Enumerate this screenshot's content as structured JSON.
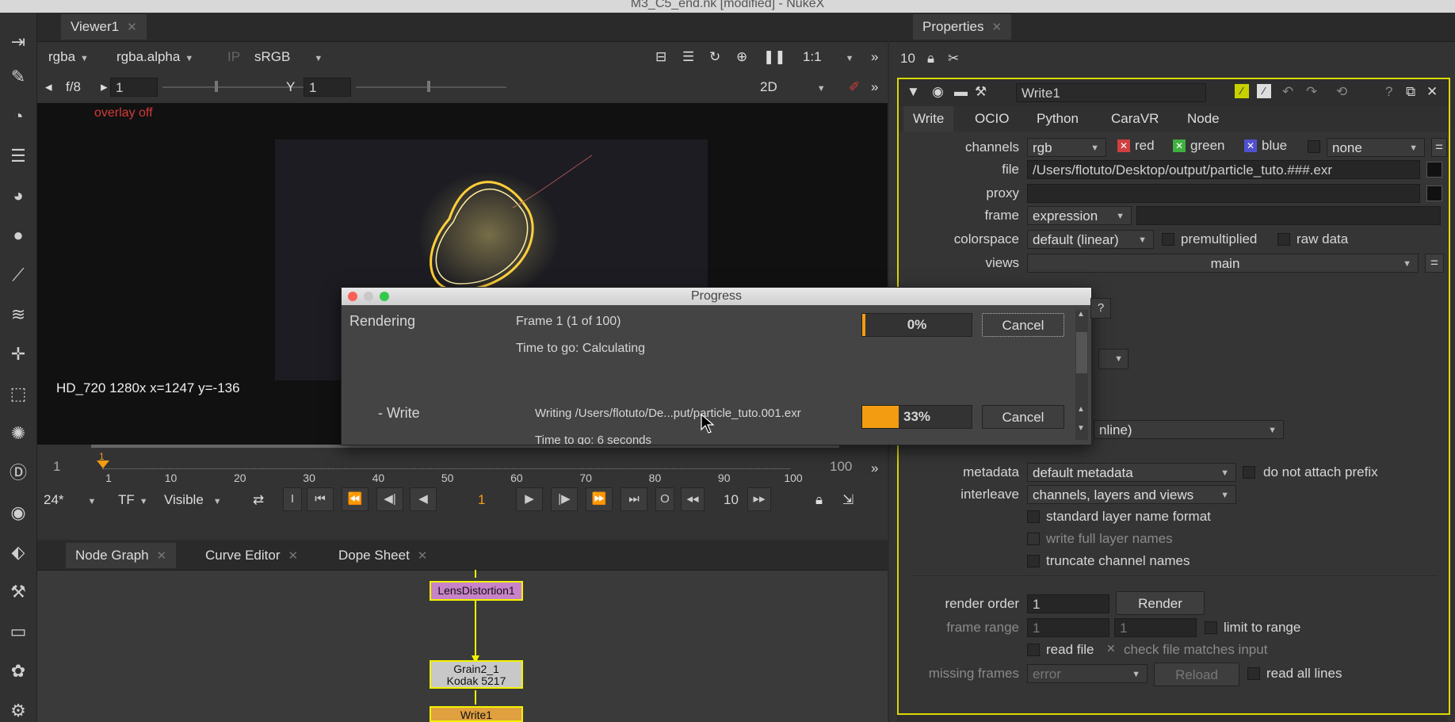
{
  "app": {
    "window_title": "M3_C5_end.nk [modified] - NukeX"
  },
  "viewer": {
    "tab_label": "Viewer1",
    "channels": "rgba",
    "alpha_channel": "rgba.alpha",
    "colorspace": "sRGB",
    "zoom": "1:1",
    "frame_label": "f/8",
    "frame_value": "1",
    "y_label": "Y",
    "y_value": "1",
    "view_mode": "2D",
    "overlay_text": "overlay off",
    "status_text": "HD_720 1280x  x=1247 y=-136"
  },
  "timeline": {
    "start": "1",
    "end": "100",
    "current_marker": "1",
    "ticks": [
      "1",
      "10",
      "20",
      "30",
      "40",
      "50",
      "60",
      "70",
      "80",
      "90",
      "100"
    ],
    "fps": "24*",
    "tf": "TF",
    "visible": "Visible",
    "current_frame": "1",
    "step": "10"
  },
  "nodegraph": {
    "tabs": [
      {
        "label": "Node Graph"
      },
      {
        "label": "Curve Editor"
      },
      {
        "label": "Dope Sheet"
      }
    ],
    "nodes": {
      "lens": "LensDistortion1",
      "grain_line1": "Grain2_1",
      "grain_line2": "Kodak 5217",
      "write": "Write1"
    }
  },
  "properties": {
    "tab_label": "Properties",
    "max_panels": "10",
    "node_name": "Write1",
    "subtabs": [
      {
        "label": "Write"
      },
      {
        "label": "OCIO"
      },
      {
        "label": "Python"
      },
      {
        "label": "CaraVR"
      },
      {
        "label": "Node"
      }
    ],
    "channels_label": "channels",
    "channels_value": "rgb",
    "red": "red",
    "green": "green",
    "blue": "blue",
    "channels_extra": "none",
    "file_label": "file",
    "file_value": "/Users/flotuto/Desktop/output/particle_tuto.###.exr",
    "proxy_label": "proxy",
    "frame_label": "frame",
    "frame_value": "expression",
    "colorspace_label": "colorspace",
    "colorspace_value": "default (linear)",
    "premultiplied": "premultiplied",
    "raw_data": "raw data",
    "views_label": "views",
    "views_value": "main",
    "hidden_dropdown_fragment": "nline)",
    "metadata_label": "metadata",
    "metadata_value": "default metadata",
    "do_not_attach_prefix": "do not attach prefix",
    "interleave_label": "interleave",
    "interleave_value": "channels, layers and views",
    "standard_layer_name_format": "standard layer name format",
    "write_full_layer_names": "write full layer names",
    "truncate_channel_names": "truncate channel names",
    "render_order_label": "render order",
    "render_order_value": "1",
    "render_button": "Render",
    "frame_range_label": "frame range",
    "frame_range_start": "1",
    "frame_range_end": "1",
    "limit_to_range": "limit to range",
    "read_file": "read file",
    "check_file_matches_input": "check file matches input",
    "missing_frames_label": "missing frames",
    "missing_frames_value": "error",
    "reload_button": "Reload",
    "read_all_lines": "read all lines"
  },
  "progress": {
    "title": "Progress",
    "rendering_label": "Rendering",
    "frame_info": "Frame 1 (1 of 100)",
    "time_to_go": "Time to go: Calculating",
    "percent_1": "0%",
    "progress_1": 0.0,
    "cancel_1": "Cancel",
    "write_label": "- Write",
    "writing_info": "Writing /Users/flotuto/De...put/particle_tuto.001.exr",
    "time_to_go_2": "Time to go: 6 seconds",
    "percent_2": "33%",
    "progress_2": 0.33,
    "cancel_2": "Cancel"
  },
  "colors": {
    "accent_orange": "#f39c12",
    "node_yellow": "#f2f200",
    "overlay_red": "#d43a3a"
  }
}
